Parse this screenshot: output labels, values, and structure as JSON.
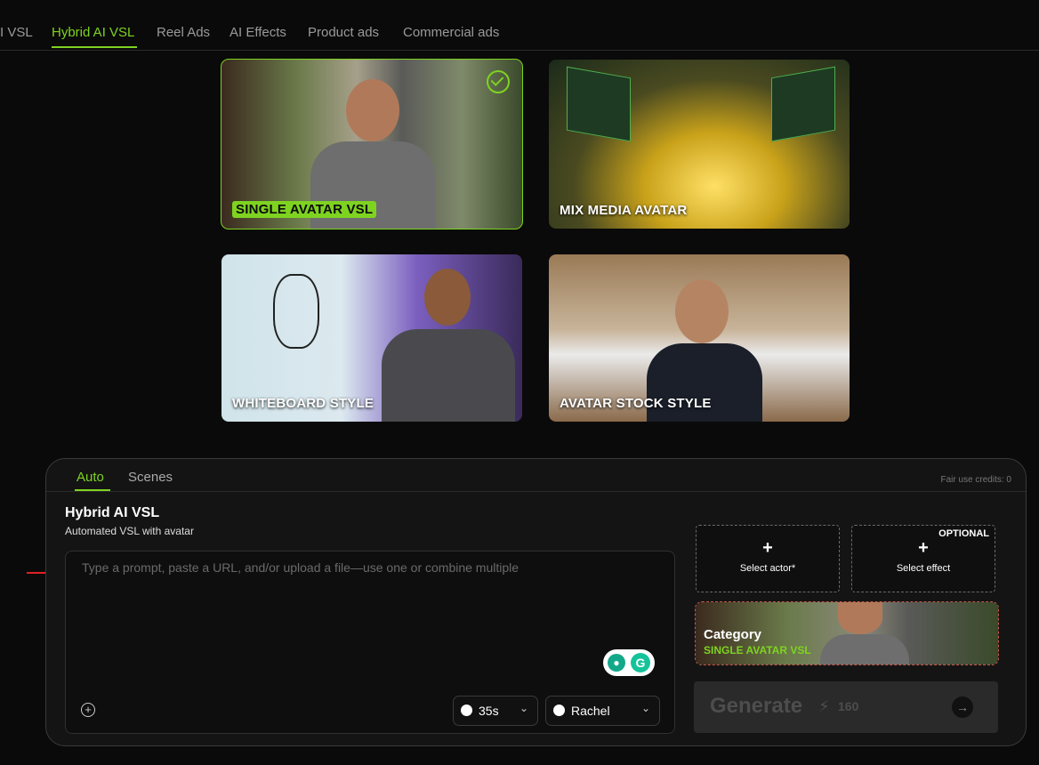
{
  "top_tabs": [
    {
      "label": "AI VSL"
    },
    {
      "label": "Hybrid AI VSL"
    },
    {
      "label": "Reel Ads"
    },
    {
      "label": "AI Effects"
    },
    {
      "label": "Product ads"
    },
    {
      "label": "Commercial ads"
    }
  ],
  "active_tab": "Hybrid AI VSL",
  "styles": [
    {
      "label": "SINGLE AVATAR VSL",
      "selected": true
    },
    {
      "label": "MIX MEDIA AVATAR",
      "selected": false
    },
    {
      "label": "WHITEBOARD STYLE",
      "selected": false
    },
    {
      "label": "AVATAR STOCK STYLE",
      "selected": false
    }
  ],
  "panel": {
    "tabs": [
      "Auto",
      "Scenes"
    ],
    "credits": "Fair use credits: 0",
    "title": "Hybrid AI VSL",
    "subtitle": "Automated VSL with avatar",
    "prompt_placeholder": "Type a prompt, paste a URL, and/or upload a file—use one or combine multiple",
    "duration": "35s",
    "voice": "Rachel",
    "select_actor": "Select actor*",
    "select_effect": "Select effect",
    "optional": "OPTIONAL",
    "category_title": "Category",
    "category_value": "SINGLE AVATAR VSL",
    "generate_label": "Generate",
    "generate_cost": "160"
  },
  "colors": {
    "accent": "#7ed321",
    "background": "#0a0a0a",
    "panel": "#141414"
  }
}
